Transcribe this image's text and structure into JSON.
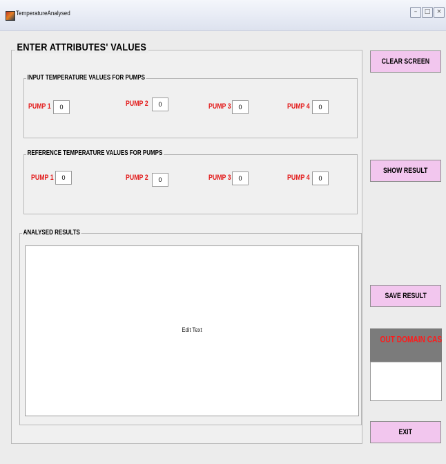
{
  "window": {
    "title": "TemperatureAnalysed",
    "icon": "matlab-icon",
    "minimize_icon": "minimize-icon",
    "maximize_icon": "maximize-icon",
    "close_icon": "close-icon"
  },
  "attributes": {
    "title": "ENTER ATTRIBUTES' VALUES",
    "input_panel": {
      "title": "INPUT TEMPERATURE VALUES FOR PUMPS",
      "pumps": [
        {
          "label": "PUMP 1",
          "value": "0"
        },
        {
          "label": "PUMP 2",
          "value": "0"
        },
        {
          "label": "PUMP 3",
          "value": "0"
        },
        {
          "label": "PUMP 4",
          "value": "0"
        }
      ]
    },
    "reference_panel": {
      "title": "REFERENCE TEMPERATURE VALUES FOR PUMPS",
      "pumps": [
        {
          "label": "PUMP 1",
          "value": "0"
        },
        {
          "label": "PUMP 2",
          "value": "0"
        },
        {
          "label": "PUMP 3",
          "value": "0"
        },
        {
          "label": "PUMP 4",
          "value": "0"
        }
      ]
    },
    "results_panel": {
      "title": "ANALYSED RESULTS",
      "text": "Edit Text"
    }
  },
  "buttons": {
    "clear": "CLEAR SCREEN",
    "show": "SHOW RESULT",
    "save": "SAVE RESULT",
    "exit": "EXIT"
  },
  "out_domain": {
    "title": "OUT DOMAIN CASES",
    "value": ""
  },
  "colors": {
    "pump_label": "#e31b1b",
    "button_bg": "#f2c6ee",
    "out_domain_header_bg": "#7b7b7b",
    "out_domain_text": "#ff1a1a"
  }
}
